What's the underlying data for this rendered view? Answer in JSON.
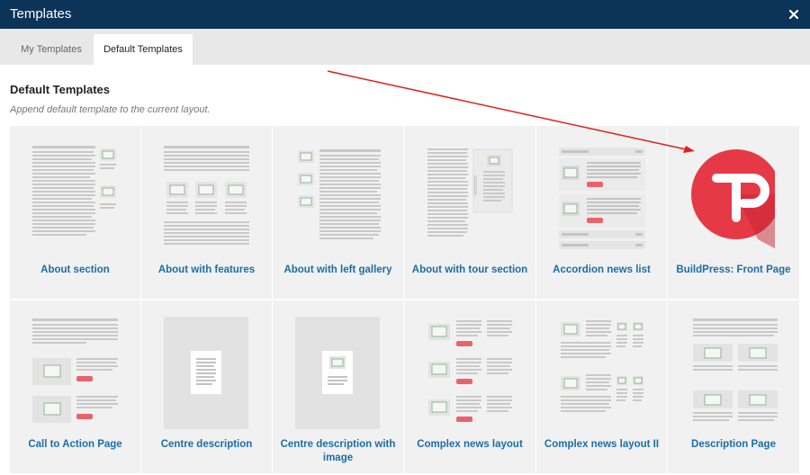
{
  "window": {
    "title": "Templates"
  },
  "tabs": [
    {
      "label": "My Templates",
      "active": false
    },
    {
      "label": "Default Templates",
      "active": true
    }
  ],
  "section": {
    "title": "Default Templates",
    "subtitle": "Append default template to the current layout."
  },
  "templates": [
    {
      "label": "About section"
    },
    {
      "label": "About with features"
    },
    {
      "label": "About with left gallery"
    },
    {
      "label": "About with tour section"
    },
    {
      "label": "Accordion news list"
    },
    {
      "label": "BuildPress: Front Page"
    },
    {
      "label": "Call to Action Page"
    },
    {
      "label": "Centre description"
    },
    {
      "label": "Centre description with image"
    },
    {
      "label": "Complex news layout"
    },
    {
      "label": "Complex news layout II"
    },
    {
      "label": "Description Page"
    }
  ],
  "colors": {
    "titlebar": "#0c3358",
    "link": "#1b6ea5",
    "card_bg": "#f1f1f1",
    "accent_red": "#e8464b",
    "annotation_arrow": "#e02020"
  }
}
